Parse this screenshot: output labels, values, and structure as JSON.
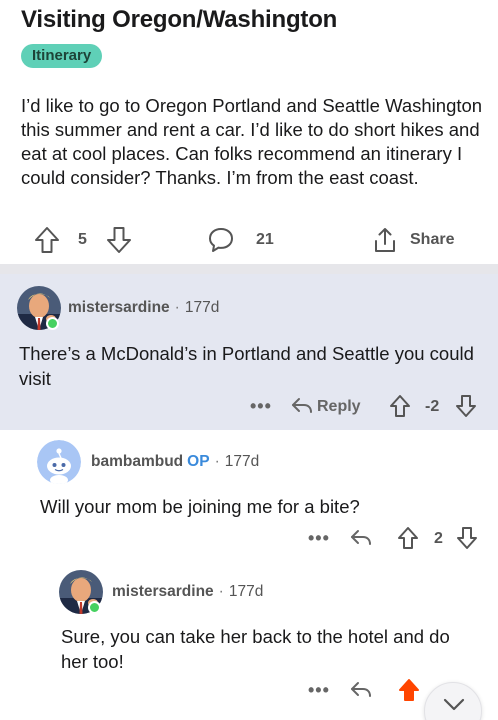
{
  "post": {
    "title": "Visiting Oregon/Washington",
    "flair": "Itinerary",
    "body": "I’d like to go to Oregon Portland and Seattle Washington this summer and rent a car. I’d like to do short hikes and eat at cool places. Can folks recommend an itinerary I could consider? Thanks. I’m from the east coast.",
    "upvotes": "5",
    "comments_count": "21",
    "share_label": "Share"
  },
  "comments": [
    {
      "username": "mistersardine",
      "op_badge": "",
      "separator": "·",
      "age": "177d",
      "text": "There’s a McDonald’s in Portland and Seattle you could visit",
      "more_label": "•••",
      "reply_label": "Reply",
      "score": "-2"
    },
    {
      "username": "bambambud",
      "op_badge": "OP",
      "separator": "·",
      "age": "177d",
      "text": "Will your mom be joining me for a bite?",
      "more_label": "•••",
      "score": "2"
    },
    {
      "username": "mistersardine",
      "op_badge": "",
      "separator": "·",
      "age": "177d",
      "text": "Sure, you can take her back to the hotel and do her too!",
      "more_label": "•••",
      "upvoted": true
    }
  ],
  "icons": {
    "upvote": "arrow-up-icon",
    "downvote": "arrow-down-icon",
    "comment": "speech-bubble-icon",
    "share": "share-icon",
    "reply": "reply-arrow-icon",
    "scroll": "chevron-down-icon"
  },
  "colors": {
    "flair_bg": "#5fd0b7",
    "highlighted_comment_bg": "#e4e7f1",
    "op_blue": "#3a8adb",
    "upvoted_orange": "#ff4500",
    "online_green": "#46d160"
  }
}
